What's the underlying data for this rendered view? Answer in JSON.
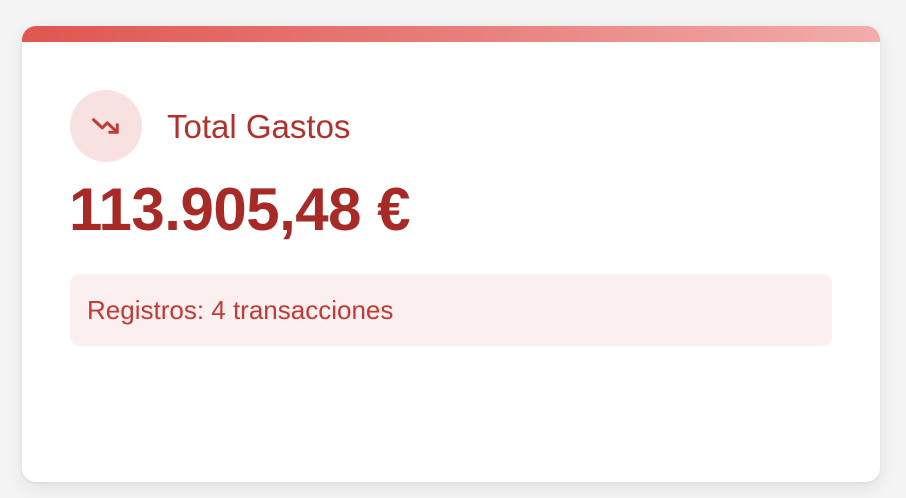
{
  "card": {
    "title": "Total Gastos",
    "icon": "trending-down-icon",
    "amount": "113.905,48 €",
    "records_text": "Registros: 4 transacciones"
  },
  "colors": {
    "accent_start": "#e05652",
    "accent_end": "#f2adab",
    "title": "#b3302b",
    "amount": "#a82a27",
    "icon_bg": "#f8e1e1",
    "records_bg": "#fcefef",
    "records_text": "#c23a35"
  }
}
